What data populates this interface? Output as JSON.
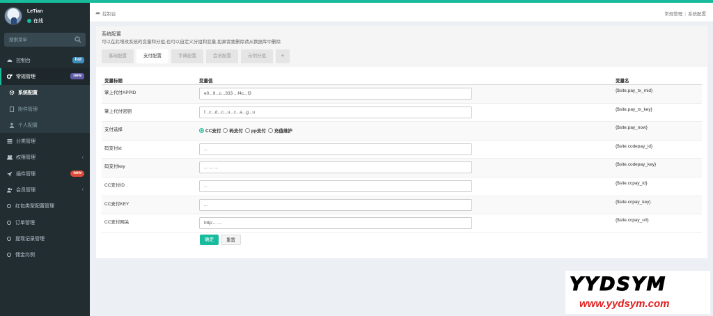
{
  "user": {
    "name": "LeTian",
    "status": "在线"
  },
  "search": {
    "placeholder": "搜索菜单"
  },
  "menu": [
    {
      "label": "控制台",
      "icon": "dashboard-icon",
      "badge": "hot"
    },
    {
      "label": "常规管理",
      "icon": "cogs-icon",
      "badge": "new"
    },
    {
      "label": "系统配置",
      "icon": "gear-icon"
    },
    {
      "label": "附件管理",
      "icon": "file-icon"
    },
    {
      "label": "个人配置",
      "icon": "user-icon"
    },
    {
      "label": "分类管理",
      "icon": "list-icon"
    },
    {
      "label": "权限管理",
      "icon": "group-icon"
    },
    {
      "label": "插件管理",
      "icon": "rocket-icon",
      "badge": "new"
    },
    {
      "label": "会员管理",
      "icon": "users-icon"
    },
    {
      "label": "红包类型配置管理",
      "icon": "circle-icon"
    },
    {
      "label": "订单管理",
      "icon": "circle-icon"
    },
    {
      "label": "提现记录管理",
      "icon": "circle-icon"
    },
    {
      "label": "佣金比例",
      "icon": "circle-icon"
    }
  ],
  "breadcrumb": {
    "home": "控制台",
    "right1": "常规管理",
    "right2": "系统配置"
  },
  "panel": {
    "title": "系统配置",
    "desc": "可以在此增改系统的变量和分组,也可以自定义分组和变量,如果需要删除请从数据库中删除",
    "tabs": [
      "基础配置",
      "支付配置",
      "字典配置",
      "会员配置",
      "示例分组",
      "+"
    ],
    "active_tab": "支付配置"
  },
  "table": {
    "headers": [
      "变量标题",
      "变量值",
      "变量名"
    ],
    "rows": [
      {
        "title": "掌上代付APPID",
        "value": "e0...9...c...333 ...f4c...f3",
        "name": "{$site.pay_tx_mid}"
      },
      {
        "title": "掌上代付密钥",
        "value": "f...c...d...c...u...c...a...g...u",
        "name": "{$site.pay_tx_key}"
      },
      {
        "title": "支付选择",
        "options": [
          "CC支付",
          "码支付",
          "pp支付",
          "充值维护"
        ],
        "selected": "CC支付",
        "name": "{$site.pay_now}"
      },
      {
        "title": "码支付id",
        "value": "...",
        "name": "{$site.codepay_id}"
      },
      {
        "title": "码支付key",
        "value": "... ... ...",
        "name": "{$site.codepay_key}"
      },
      {
        "title": "CC支付ID",
        "value": "...",
        "name": "{$site.ccpay_id}"
      },
      {
        "title": "CC支付KEY",
        "value": "...",
        "name": "{$site.ccpay_key}"
      },
      {
        "title": "CC支付网关",
        "value": "http:... ...",
        "name": "{$site.ccpay_url}"
      }
    ]
  },
  "buttons": {
    "ok": "确定",
    "reset": "重置"
  },
  "watermark": {
    "big": "YYDSYM",
    "small": "www.yydsym.com"
  },
  "colors": {
    "accent": "#18bc9c",
    "sidebar": "#222d32"
  }
}
